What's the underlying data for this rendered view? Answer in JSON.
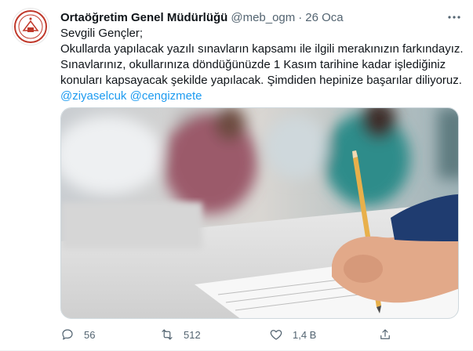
{
  "tweet": {
    "display_name": "Ortaöğretim Genel Müdürlüğü",
    "handle": "@meb_ogm",
    "separator": "·",
    "date": "26 Oca",
    "lines": [
      "Sevgili Gençler;",
      "Okullarda yapılacak yazılı sınavların kapsamı ile ilgili merakınızın farkındayız.",
      "Sınavlarınız, okullarınıza döndüğünüzde 1 Kasım tarihine kadar işlediğiniz",
      "konuları kapsayacak şekilde yapılacak. Şimdiden hepinize başarılar diliyoruz."
    ],
    "mentions": [
      "@ziyaselcuk",
      "@cengizmete"
    ],
    "actions": {
      "replies": "56",
      "retweets": "512",
      "likes": "1,4 B"
    },
    "icons": {
      "more": "more-horizontal-icon",
      "reply": "reply-icon",
      "retweet": "retweet-icon",
      "like": "heart-icon",
      "share": "share-icon"
    },
    "colors": {
      "link": "#1d9bf0",
      "muted": "#536471",
      "text": "#0f1419"
    }
  }
}
